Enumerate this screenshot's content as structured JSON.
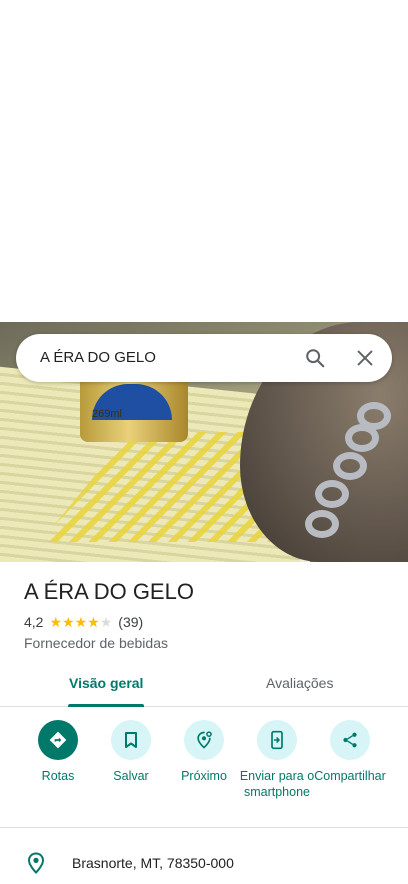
{
  "search": {
    "query": "A ÉRA DO GELO"
  },
  "place": {
    "title": "A ÉRA DO GELO",
    "rating": "4,2",
    "rating_value": 4.2,
    "review_count": "(39)",
    "category": "Fornecedor de bebidas"
  },
  "photo": {
    "can_text": "269ml"
  },
  "tabs": [
    {
      "label": "Visão geral",
      "active": true
    },
    {
      "label": "Avaliações",
      "active": false
    }
  ],
  "actions": [
    {
      "label": "Rotas",
      "icon": "directions-icon"
    },
    {
      "label": "Salvar",
      "icon": "bookmark-icon"
    },
    {
      "label": "Próximo",
      "icon": "nearby-icon"
    },
    {
      "label": "Enviar para o smartphone",
      "icon": "send-to-phone-icon"
    },
    {
      "label": "Compartilhar",
      "icon": "share-icon"
    }
  ],
  "address": {
    "text": "Brasnorte, MT, 78350-000",
    "icon": "location-pin-icon"
  },
  "colors": {
    "accent": "#00796b",
    "action_bg": "#d7f4f6",
    "star": "#fbbc04"
  }
}
